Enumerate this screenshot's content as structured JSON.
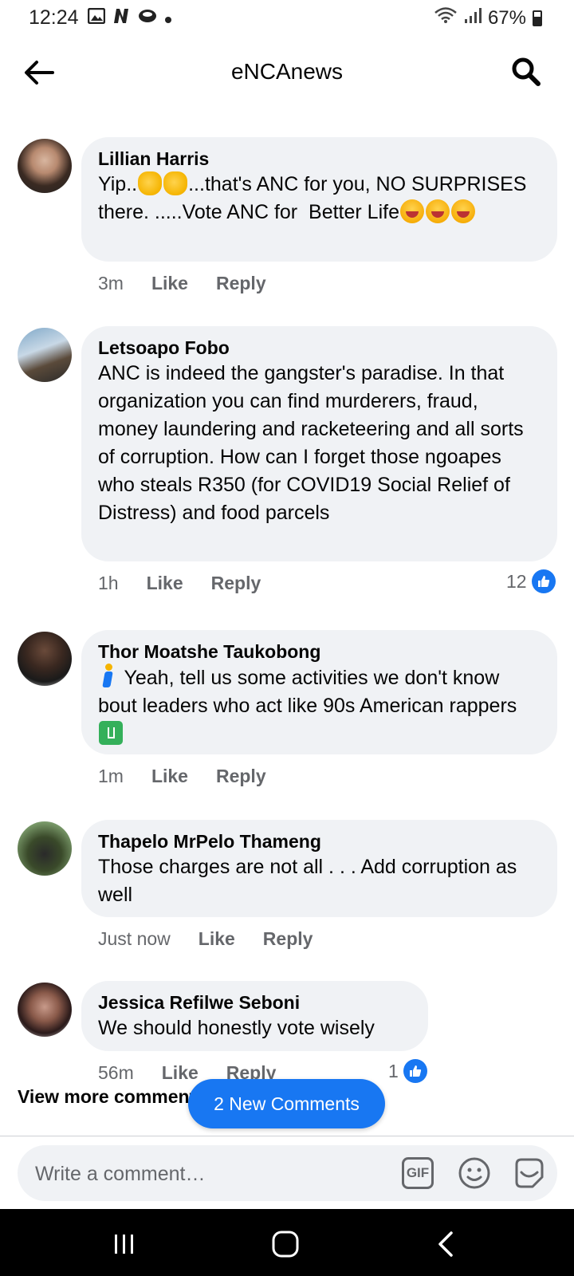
{
  "status_bar": {
    "time": "12:24",
    "battery": "67%"
  },
  "header": {
    "title": "eNCAnews"
  },
  "comments": [
    {
      "author": "Lillian Harris",
      "text_parts": [
        "Yip..",
        "...that's ANC for you, NO SURPRISES there. .....Vote ANC for  Better Life"
      ],
      "time": "3m",
      "like": "Like",
      "reply": "Reply"
    },
    {
      "author": "Letsoapo Fobo",
      "text": "ANC is indeed the gangster's paradise. In that organization you can find murderers, fraud, money laundering and racketeering and all sorts of corruption. How can I forget those ngoapes who steals R350 (for COVID19 Social Relief of Distress) and food parcels",
      "time": "1h",
      "like": "Like",
      "reply": "Reply",
      "reaction_count": "12"
    },
    {
      "author": "Thor Moatshe Taukobong",
      "text_parts": [
        " Yeah, tell us some activities we don't know bout leaders who act like 90s American rappers"
      ],
      "time": "1m",
      "like": "Like",
      "reply": "Reply"
    },
    {
      "author": "Thapelo MrPelo Thameng",
      "text": "Those charges are not all . . . Add corruption as well",
      "time": "Just now",
      "like": "Like",
      "reply": "Reply"
    },
    {
      "author": "Jessica Refilwe Seboni",
      "text": "We should honestly vote wisely",
      "time": "56m",
      "like": "Like",
      "reply": "Reply",
      "reaction_count": "1"
    }
  ],
  "view_more": "View more comments",
  "new_comments_button": "2 New Comments",
  "composer": {
    "placeholder": "Write a comment…",
    "gif_label": "GIF"
  },
  "colors": {
    "accent": "#1877f2",
    "bubble": "#f0f2f5",
    "secondary_text": "#65676b"
  }
}
